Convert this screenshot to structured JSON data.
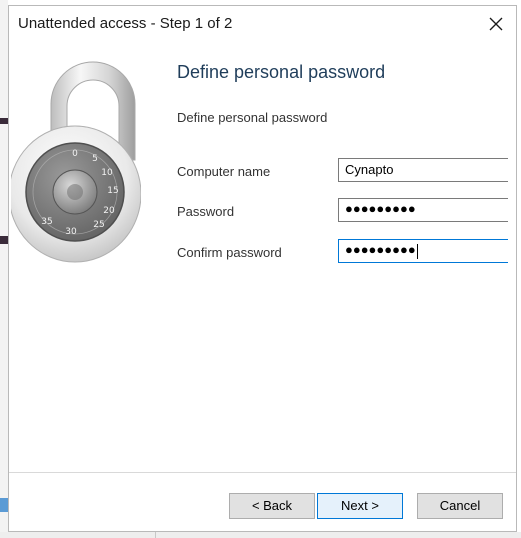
{
  "dialog": {
    "title": "Unattended access - Step 1 of 2",
    "close_icon": "close-icon"
  },
  "content": {
    "heading": "Define personal password",
    "subheading": "Define personal password",
    "illustration": "padlock-illustration",
    "lock_dial_numbers": [
      "0",
      "5",
      "10",
      "15",
      "20",
      "25",
      "30",
      "35"
    ]
  },
  "form": {
    "computer_name": {
      "label": "Computer name",
      "value": "Cynapto"
    },
    "password": {
      "label": "Password",
      "value": "●●●●●●●●●"
    },
    "confirm_password": {
      "label": "Confirm password",
      "value": "●●●●●●●●●"
    }
  },
  "buttons": {
    "back": "< Back",
    "next": "Next >",
    "cancel": "Cancel"
  },
  "colors": {
    "accent": "#0078d7",
    "heading": "#1f3d5a"
  }
}
